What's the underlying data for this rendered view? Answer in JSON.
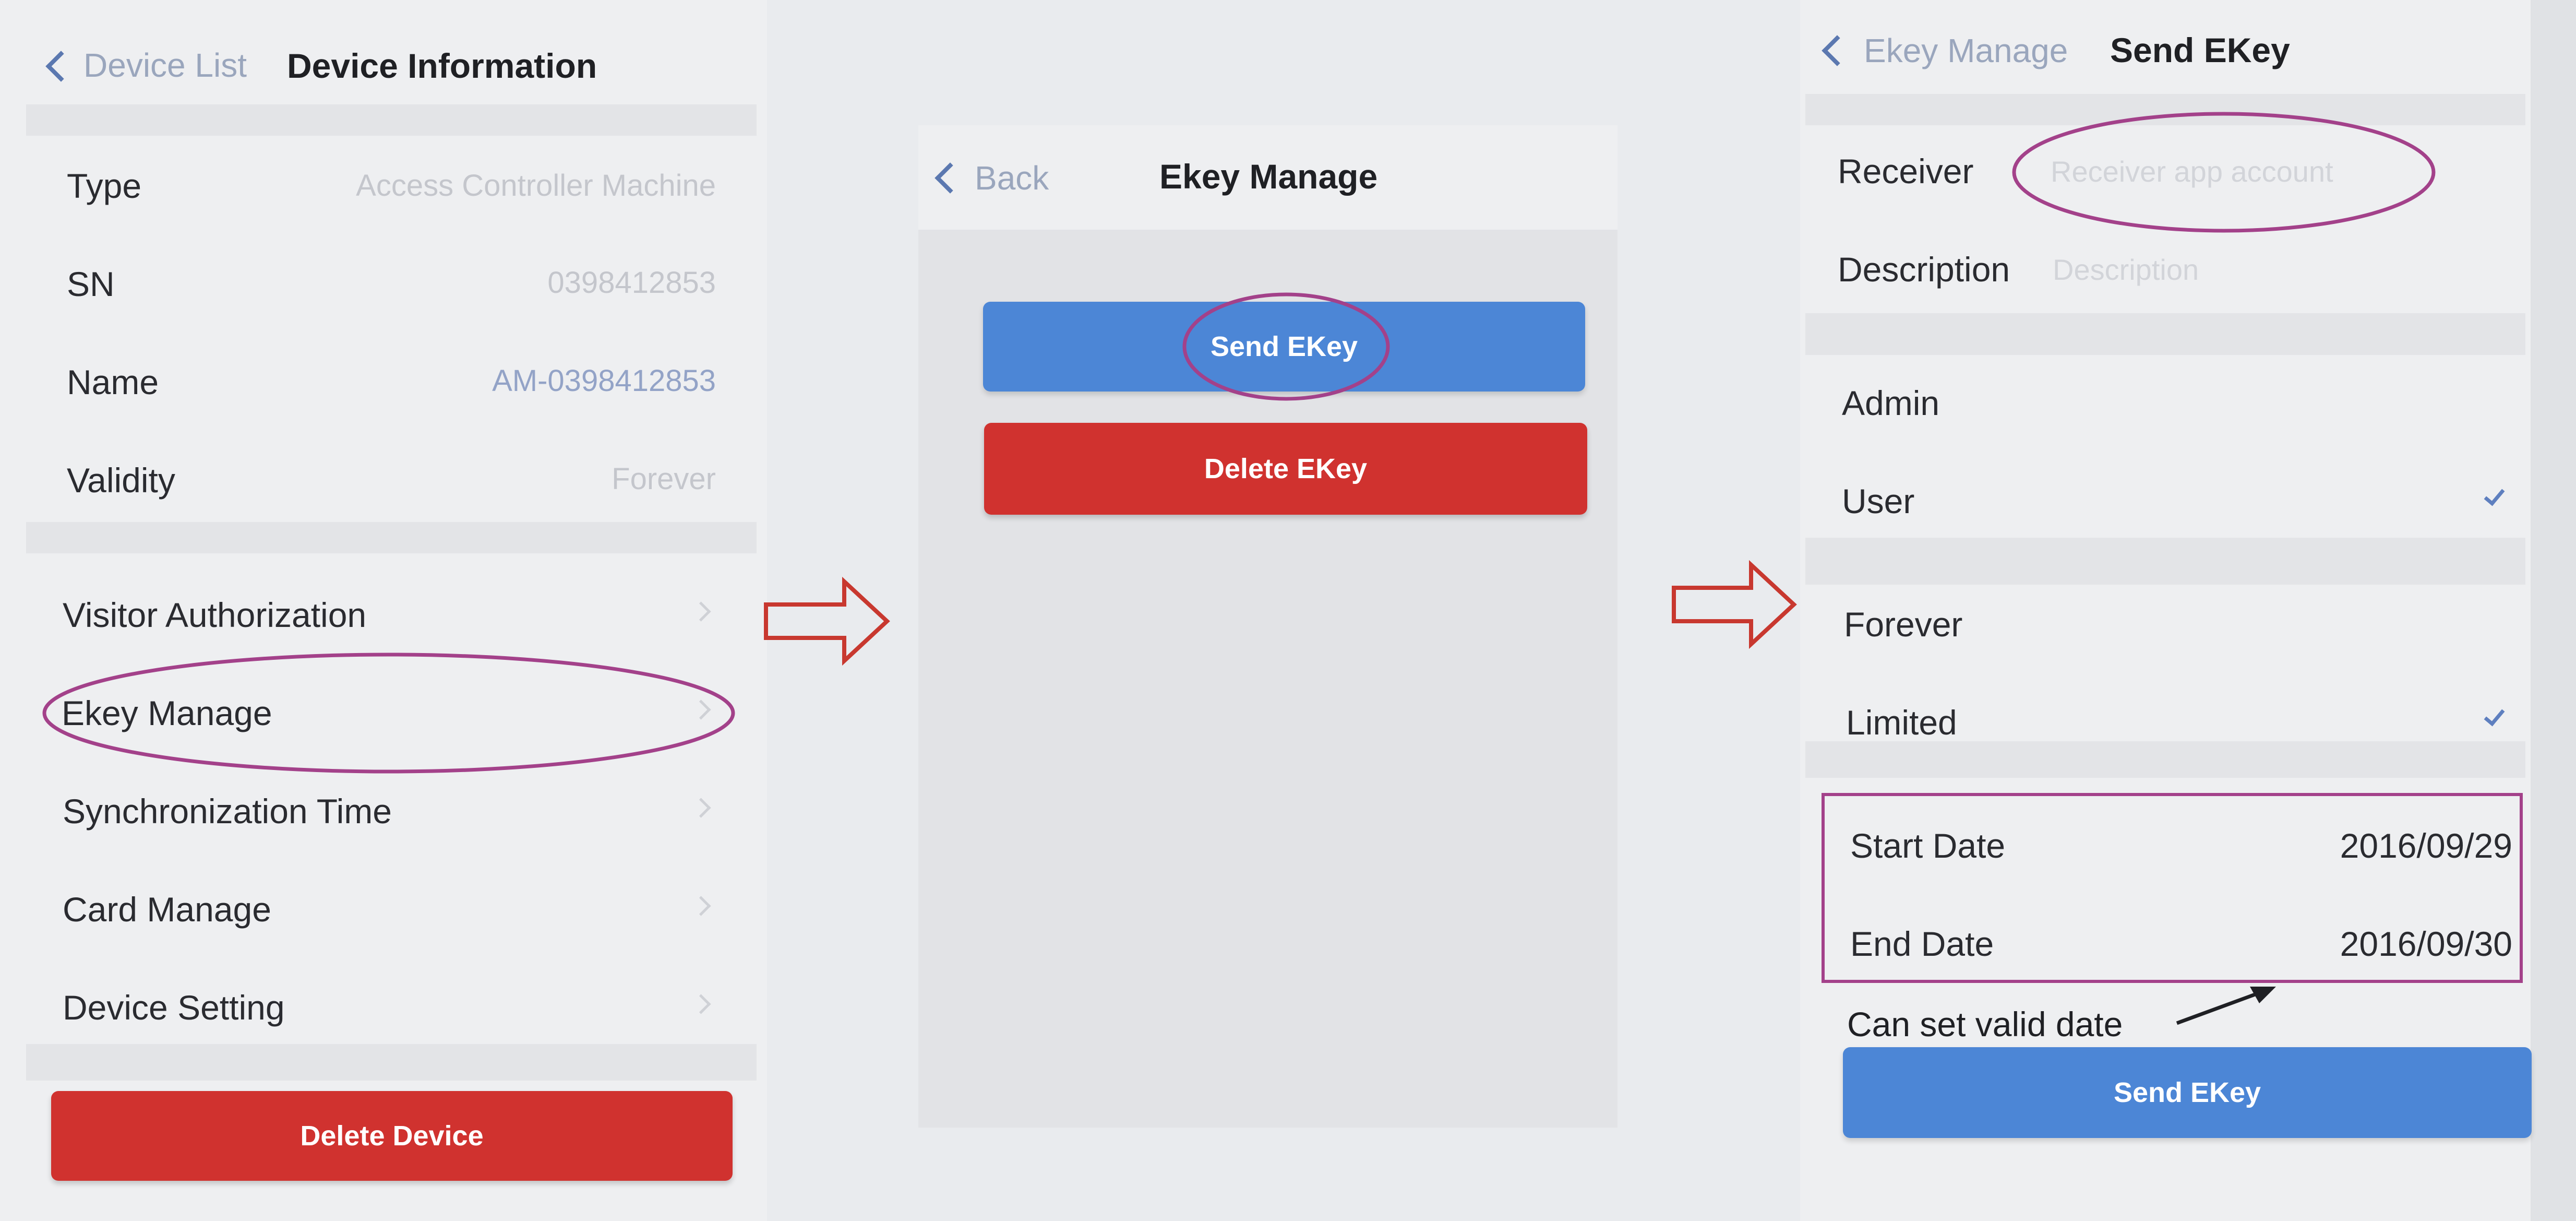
{
  "colors": {
    "accent_blue": "#4c86d6",
    "danger_red": "#d0322f",
    "annotation_magenta": "#a3418a",
    "arrow_red": "#c8382f"
  },
  "device_info": {
    "back_label": "Device List",
    "title": "Device Information",
    "fields": [
      {
        "label": "Type",
        "value": "Access Controller Machine"
      },
      {
        "label": "SN",
        "value": "0398412853"
      },
      {
        "label": "Name",
        "value": "AM-0398412853"
      },
      {
        "label": "Validity",
        "value": "Forever"
      }
    ],
    "menu": [
      {
        "label": "Visitor Authorization",
        "icon": "chevron-right-icon"
      },
      {
        "label": "Ekey Manage",
        "icon": "chevron-right-icon"
      },
      {
        "label": "Synchronization Time",
        "icon": "chevron-right-icon"
      },
      {
        "label": "Card Manage",
        "icon": "chevron-right-icon"
      },
      {
        "label": "Device Setting",
        "icon": "chevron-right-icon"
      }
    ],
    "delete_button": "Delete Device"
  },
  "ekey_manage": {
    "back_label": "Back",
    "title": "Ekey Manage",
    "send_button": "Send EKey",
    "delete_button": "Delete EKey"
  },
  "send_ekey": {
    "back_label": "Ekey Manage",
    "title": "Send EKey",
    "receiver_label": "Receiver",
    "receiver_placeholder": "Receiver app account",
    "description_label": "Description",
    "description_placeholder": "Description",
    "roles": [
      {
        "label": "Admin",
        "checked": false
      },
      {
        "label": "User",
        "checked": true
      }
    ],
    "validity": [
      {
        "label": "Forever",
        "checked": false
      },
      {
        "label": "Limited",
        "checked": true
      }
    ],
    "start_date": {
      "label": "Start Date",
      "value": "2016/09/29"
    },
    "end_date": {
      "label": "End Date",
      "value": "2016/09/30"
    },
    "note": "Can set valid date",
    "send_button": "Send EKey"
  }
}
